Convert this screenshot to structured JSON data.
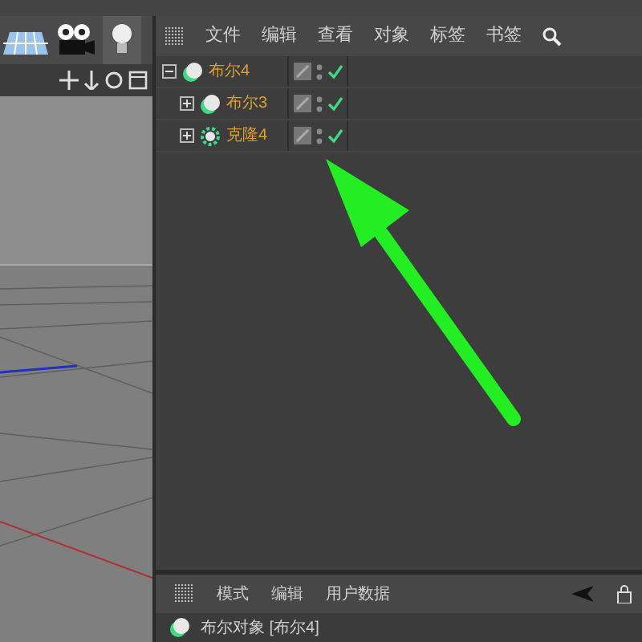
{
  "object_manager": {
    "menu": [
      "文件",
      "编辑",
      "查看",
      "对象",
      "标签",
      "书签"
    ],
    "objects": [
      {
        "name": "布尔4",
        "kind": "boole",
        "expanded": true,
        "enabled": true,
        "children": [
          {
            "name": "布尔3",
            "kind": "boole",
            "expanded": false,
            "enabled": true
          },
          {
            "name": "克隆4",
            "kind": "cloner",
            "expanded": false,
            "enabled": true
          }
        ]
      }
    ]
  },
  "attributes": {
    "menu": [
      "模式",
      "编辑",
      "用户数据"
    ],
    "title": "布尔对象 [布尔4]"
  }
}
